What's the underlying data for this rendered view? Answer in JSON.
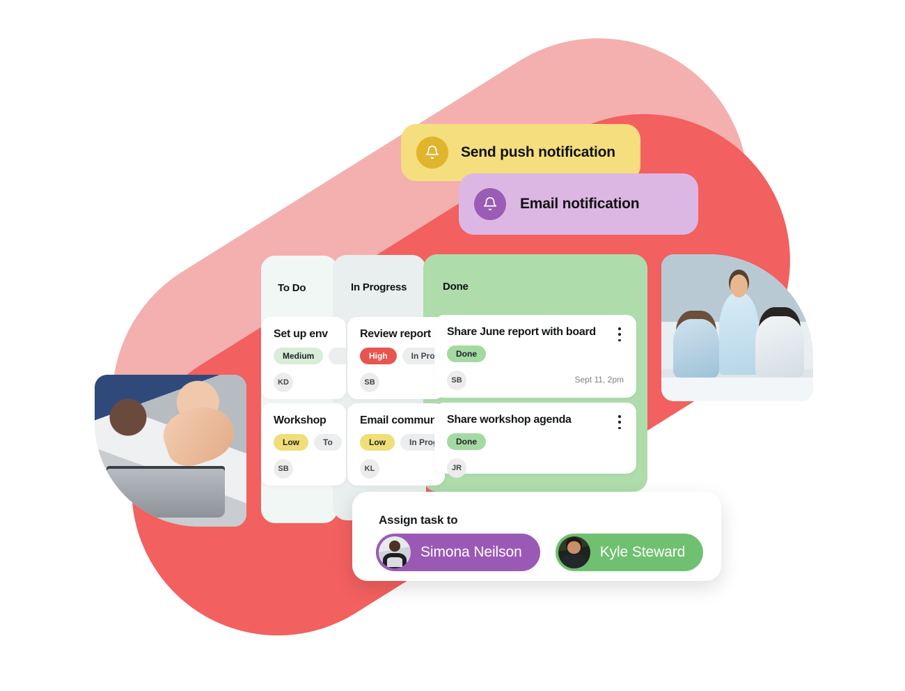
{
  "notifications": [
    {
      "label": "Send push notification",
      "icon": "bell-icon",
      "bg": "#F5DE7D",
      "badge": "#E0B42C"
    },
    {
      "label": "Email notification",
      "icon": "bell-icon",
      "bg": "#DCB7E4",
      "badge": "#9A5CB4"
    }
  ],
  "board": {
    "columns": [
      {
        "title": "To Do",
        "bg": "#F1F7F5"
      },
      {
        "title": "In Progress",
        "bg": "#E9EFEE"
      },
      {
        "title": "Done",
        "bg": "#AEDCAB"
      }
    ],
    "todo_cards": [
      {
        "title": "Set up env",
        "tags": [
          "Medium"
        ],
        "avatar": "KD"
      },
      {
        "title": "Workshop",
        "tags": [
          "Low",
          "To"
        ],
        "avatar": "SB"
      }
    ],
    "progress_cards": [
      {
        "title": "Review report",
        "tags": [
          "High",
          "In Progre"
        ],
        "avatar": "SB"
      },
      {
        "title": "Email commun",
        "tags": [
          "Low",
          "In Progre"
        ],
        "avatar": "KL"
      }
    ],
    "done_cards": [
      {
        "title": "Share June report with board",
        "tag": "Done",
        "avatar": "SB",
        "time": "Sept 11, 2pm"
      },
      {
        "title": "Share workshop agenda",
        "tag": "Done",
        "avatar": "JR",
        "time": ""
      }
    ]
  },
  "assign": {
    "label": "Assign task to",
    "people": [
      {
        "name": "Simona Neilson",
        "color": "#9B59B6"
      },
      {
        "name": "Kyle Steward",
        "color": "#6FC070"
      }
    ]
  },
  "colors": {
    "blob_pink": "#F4AFAF",
    "blob_coral": "#F2605F",
    "tag_medium": "#D7EDD7",
    "tag_low": "#F0DE79",
    "tag_high": "#E8544F",
    "tag_done": "#A5D9A2",
    "tag_grey": "#ECEDEE"
  }
}
